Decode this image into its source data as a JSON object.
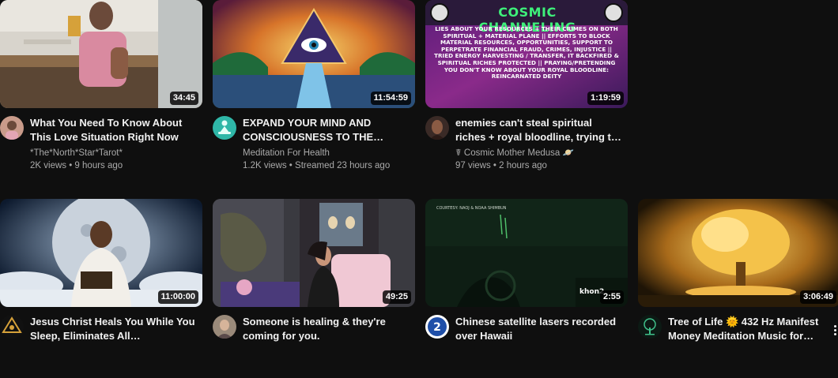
{
  "videos": [
    {
      "title": "What You Need To Know About This Love Situation Right Now❤…",
      "channel": "*The*North*Star*Tarot*",
      "stats": "2K views • 9 hours ago",
      "duration": "34:45",
      "avatar_icon": "tarot-reader-avatar"
    },
    {
      "title": "EXPAND YOUR MIND AND CONSCIOUSNESS TO THE…",
      "channel": "Meditation For Health",
      "stats": "1.2K views • Streamed 23 hours ago",
      "duration": "11:54:59",
      "avatar_icon": "meditation-figure-avatar"
    },
    {
      "title": "enemies can't steal spiritual riches + royal bloodline, trying t…",
      "channel": "☤ Cosmic Mother Medusa 🪐",
      "stats": "97 views • 2 hours ago",
      "duration": "1:19:59",
      "avatar_icon": "woman-portrait-avatar",
      "thumb_heading": "COSMIC CHANNELING",
      "thumb_body": "LIES ABOUT YOUR RESOURCES + THEIR CRIMES ON BOTH SPIRITUAL + MATERIAL PLANE || EFFORTS TO BLOCK MATERIAL RESOURCES, OPPORTUNITIES, SUPPORT TO PERPETRATE FINANCIAL FRAUD, CRIMES, INJUSTICE || TRIED ENERGY HARVESTING / TRANSFER, IT BACKFIRED & SPIRITUAL RICHES PROTECTED || PRAYING/PRETENDING YOU DON'T KNOW ABOUT YOUR ROYAL BLOODLINE: REINCARNATED DEITY"
    },
    {
      "title": "Jesus Christ Heals You While You Sleep, Eliminates All…",
      "duration": "11:00:00",
      "avatar_icon": "gold-emblem-avatar"
    },
    {
      "title": "Someone is healing & they're coming for you.",
      "duration": "49:25",
      "avatar_icon": "woman-avatar"
    },
    {
      "title": "Chinese satellite lasers recorded over Hawaii",
      "duration": "2:55",
      "avatar_icon": "khon2-logo-avatar",
      "thumb_caption": "COURTESY: NAOJ & NOAA SHIMBUN",
      "thumb_logo": "khon2"
    },
    {
      "title": "Tree of Life 🌞 432 Hz Manifest Money Meditation Music for…",
      "duration": "3:06:49",
      "avatar_icon": "tree-emblem-avatar"
    }
  ],
  "menu_icon": "more-vert-icon"
}
